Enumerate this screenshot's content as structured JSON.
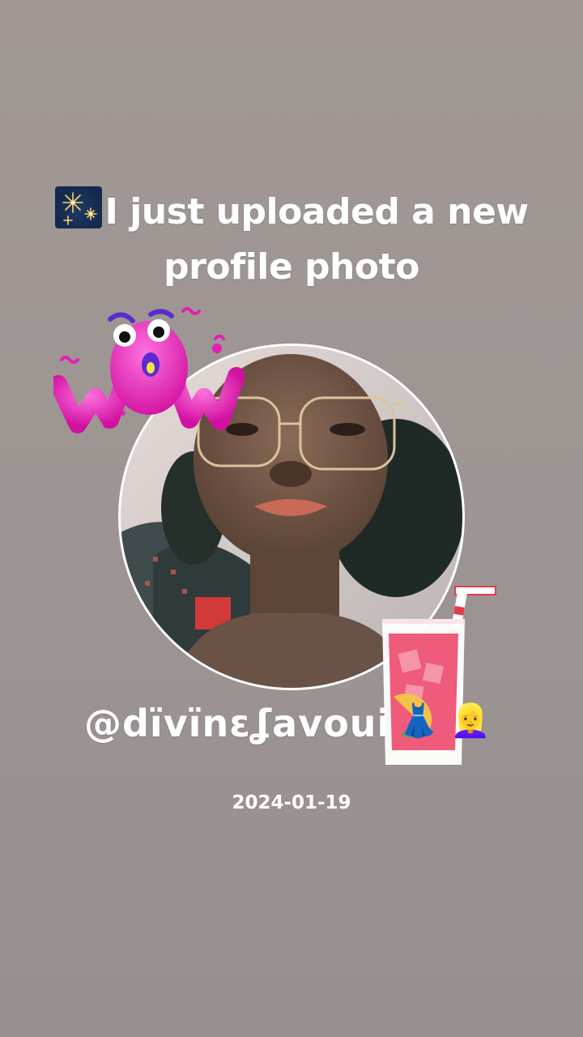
{
  "post": {
    "headline_icon": "fireworks-icon",
    "headline_line1": "I just uploaded a new",
    "headline_line2": "profile photo",
    "username": "@dïvïnɛʆavoui",
    "username_emojis": [
      "dress-icon",
      "blonde-person-icon"
    ],
    "date": "2024-01-19"
  },
  "stickers": [
    "wow-sticker",
    "pink-drink-sticker"
  ],
  "colors": {
    "background": "#9d9593",
    "text": "#ffffff",
    "frame_border": "#ffffff",
    "wow_pink": "#e11fb6",
    "drink_pink": "#ef5b7a"
  }
}
